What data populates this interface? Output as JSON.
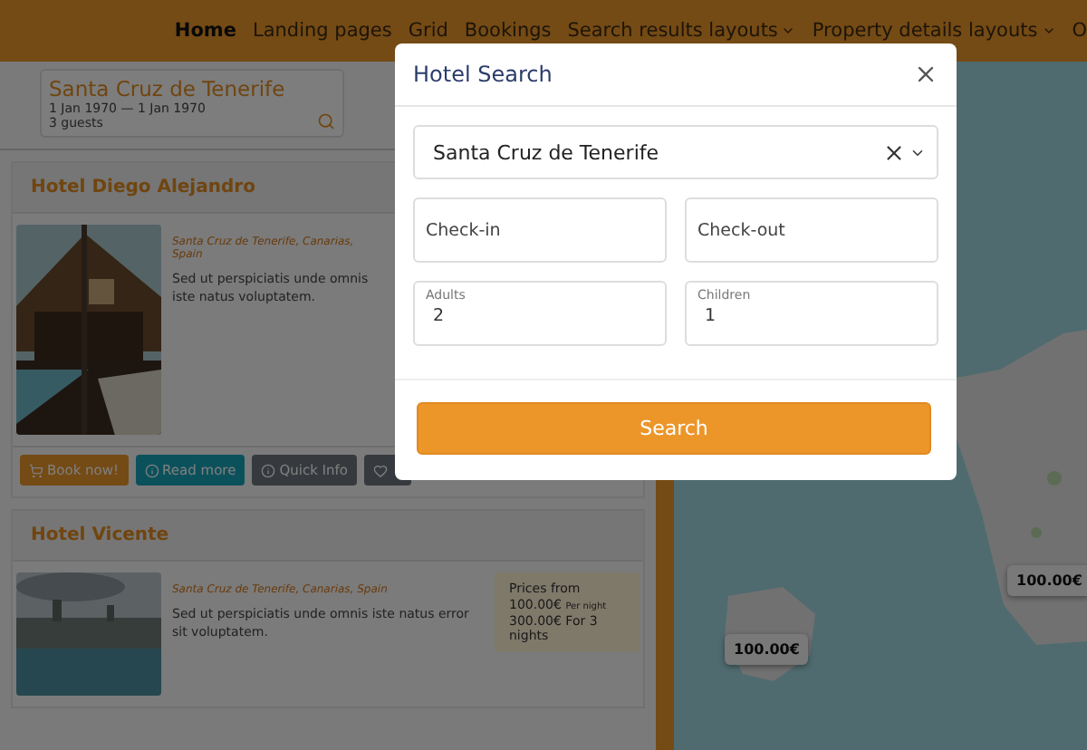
{
  "nav": {
    "items": [
      {
        "label": "Home",
        "selected": true,
        "dropdown": false
      },
      {
        "label": "Landing pages",
        "selected": false,
        "dropdown": false
      },
      {
        "label": "Grid",
        "selected": false,
        "dropdown": false
      },
      {
        "label": "Bookings",
        "selected": false,
        "dropdown": false
      },
      {
        "label": "Search results layouts",
        "selected": false,
        "dropdown": true
      },
      {
        "label": "Property details layouts",
        "selected": false,
        "dropdown": true
      },
      {
        "label": "O",
        "selected": false,
        "dropdown": false
      }
    ]
  },
  "search_summary": {
    "place": "Santa Cruz de Tenerife",
    "dates": "1 Jan 1970 — 1 Jan 1970",
    "guests": "3 guests"
  },
  "hotels": [
    {
      "name": "Hotel Diego Alejandro",
      "location": "Santa Cruz de Tenerife, Canarias, Spain",
      "description": "Sed ut perspiciatis unde omnis iste natus voluptatem.",
      "kind": "cabin",
      "buttons": [
        {
          "label": "Book now!",
          "kind": "book"
        },
        {
          "label": "Read more",
          "kind": "more"
        },
        {
          "label": "Quick Info",
          "kind": "info"
        },
        {
          "kind": "favorite"
        }
      ]
    },
    {
      "name": "Hotel Vicente",
      "location": "Santa Cruz de Tenerife, Canarias, Spain",
      "description": "Sed ut perspiciatis unde omnis iste natus error sit voluptatem.",
      "kind": "city",
      "price": {
        "heading": "Prices from",
        "nightly": "100.00€",
        "nightly_label": "Per night",
        "total": "300.00€ For 3 nights"
      }
    }
  ],
  "map": {
    "markers": [
      "100.00€",
      "100.00€"
    ]
  },
  "modal": {
    "title": "Hotel Search",
    "destination": {
      "value": "Santa Cruz de Tenerife"
    },
    "check_in": {
      "placeholder": "Check-in"
    },
    "check_out": {
      "placeholder": "Check-out"
    },
    "adults": {
      "label": "Adults",
      "value": "2"
    },
    "children": {
      "label": "Children",
      "value": "1"
    },
    "submit": "Search"
  }
}
